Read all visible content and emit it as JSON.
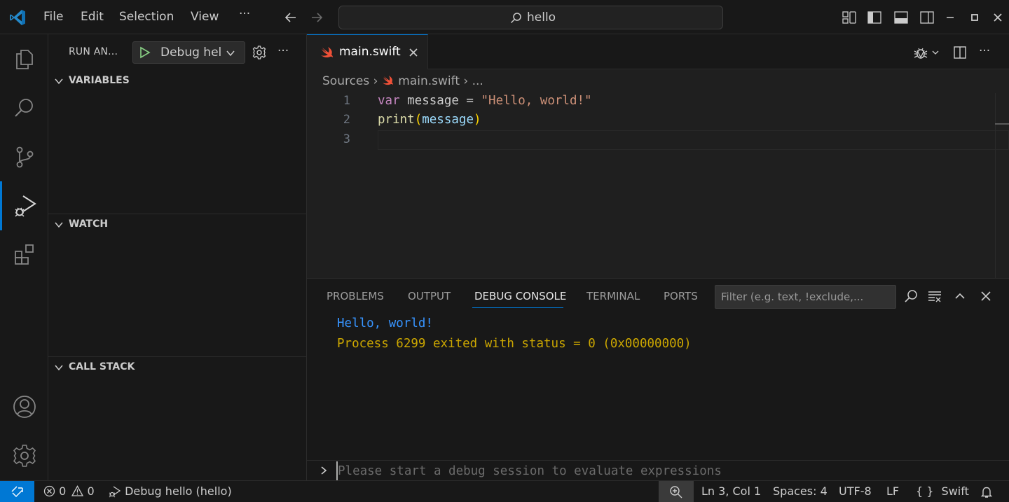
{
  "titlebar": {
    "menus": [
      "File",
      "Edit",
      "Selection",
      "View",
      "···"
    ],
    "search_text": "hello"
  },
  "sidebar": {
    "title": "RUN AN...",
    "debug_config_label": "Debug hel",
    "sections": [
      "VARIABLES",
      "WATCH",
      "CALL STACK"
    ]
  },
  "editor": {
    "tab_label": "main.swift",
    "breadcrumb": {
      "folder": "Sources",
      "file": "main.swift",
      "rest": "..."
    },
    "line_numbers": [
      "1",
      "2",
      "3"
    ],
    "code": {
      "l1_kw": "var",
      "l1_id": " message = ",
      "l1_str": "\"Hello, world!\"",
      "l2_fn": "print",
      "l2_open": "(",
      "l2_arg": "message",
      "l2_close": ")"
    }
  },
  "panel": {
    "tabs": [
      "PROBLEMS",
      "OUTPUT",
      "DEBUG CONSOLE",
      "TERMINAL",
      "PORTS"
    ],
    "active_tab": "DEBUG CONSOLE",
    "filter_placeholder": "Filter (e.g. text, !exclude,...",
    "console_lines": [
      "Hello, world!",
      "Process 6299 exited with status = 0 (0x00000000)"
    ],
    "repl_placeholder": "Please start a debug session to evaluate expressions"
  },
  "statusbar": {
    "errors": "0",
    "warnings": "0",
    "debug_label": "Debug hello (hello)",
    "position": "Ln 3, Col 1",
    "spaces": "Spaces: 4",
    "encoding": "UTF-8",
    "eol": "LF",
    "language": "Swift",
    "language_icon": "{ }"
  },
  "colors": {
    "accent": "#0078d4",
    "console_output": "#3794ff",
    "console_process": "#cca700"
  }
}
